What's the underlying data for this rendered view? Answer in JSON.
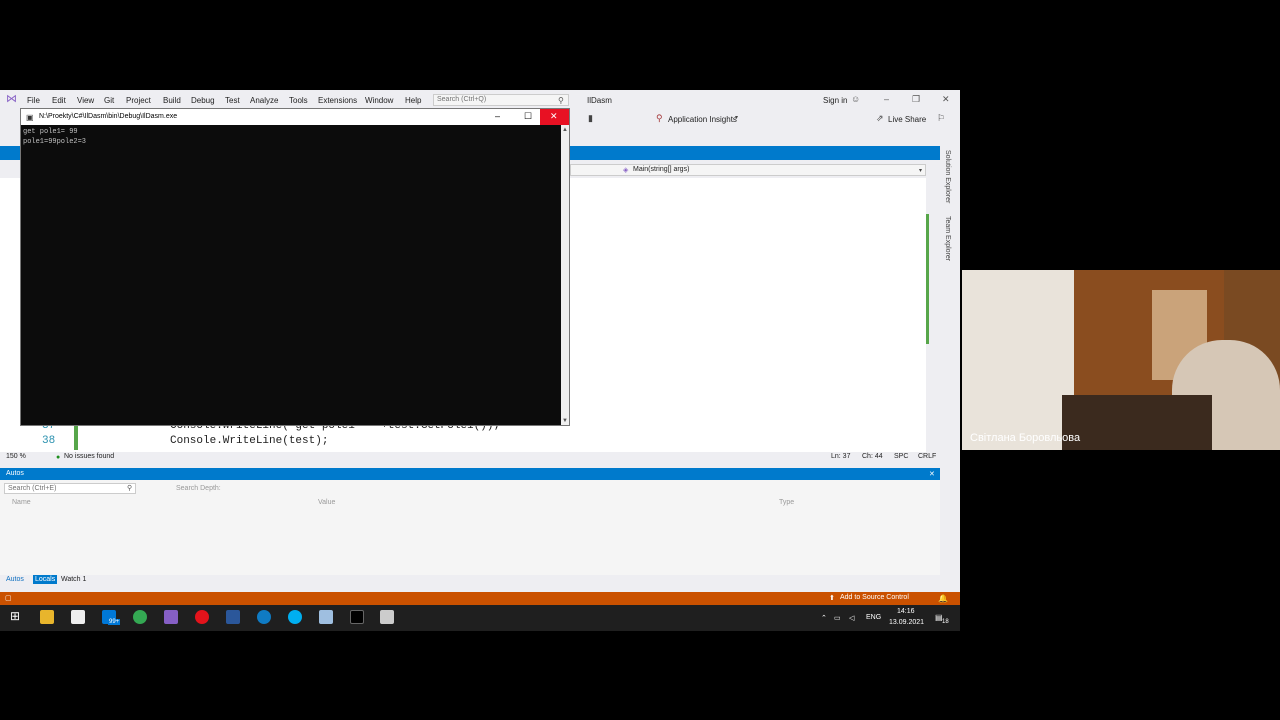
{
  "vs": {
    "menu": [
      "File",
      "Edit",
      "View",
      "Git",
      "Project",
      "Build",
      "Debug",
      "Test",
      "Analyze",
      "Tools",
      "Extensions",
      "Window",
      "Help"
    ],
    "search_placeholder": "Search (Ctrl+Q)",
    "solution_name": "IlDasm",
    "sign_in": "Sign in",
    "app_insights": "Application Insights",
    "live_share": "Live Share",
    "navbar_method": "Main(string[] args)",
    "side_tabs": [
      "Solution Explorer",
      "Team Explorer"
    ],
    "code": {
      "line37_no": "37",
      "line37_text": "Console.WriteLine(\"get pole1= \" +test.GetPole1());",
      "line38_no": "38",
      "line38_text": "Console.WriteLine(test);"
    },
    "zoom": "150 %",
    "issues": "No issues found",
    "ln": "Ln: 37",
    "ch": "Ch: 44",
    "spc": "SPC",
    "crlf": "CRLF",
    "autos": {
      "title": "Autos",
      "search_placeholder": "Search (Ctrl+E)",
      "search_depth": "Search Depth:",
      "columns": [
        "Name",
        "Value",
        "Type"
      ],
      "tabs": [
        "Autos",
        "Locals",
        "Watch 1"
      ]
    },
    "statusbar": {
      "source_control": "Add to Source Control"
    }
  },
  "console": {
    "title": "N:\\Proekty\\C#\\IlDasm\\bin\\Debug\\IlDasm.exe",
    "lines": [
      "get pole1= 99",
      "pole1=99pole2=3"
    ]
  },
  "taskbar": {
    "language": "ENG",
    "time": "14:16",
    "date": "13.09.2021",
    "badge": "99+",
    "notif_count": "18"
  },
  "webcam": {
    "name": "Світлана Боровльова"
  },
  "colors": {
    "vs_blue": "#007acc",
    "status_orange": "#ca5100",
    "close_red": "#e81123"
  }
}
